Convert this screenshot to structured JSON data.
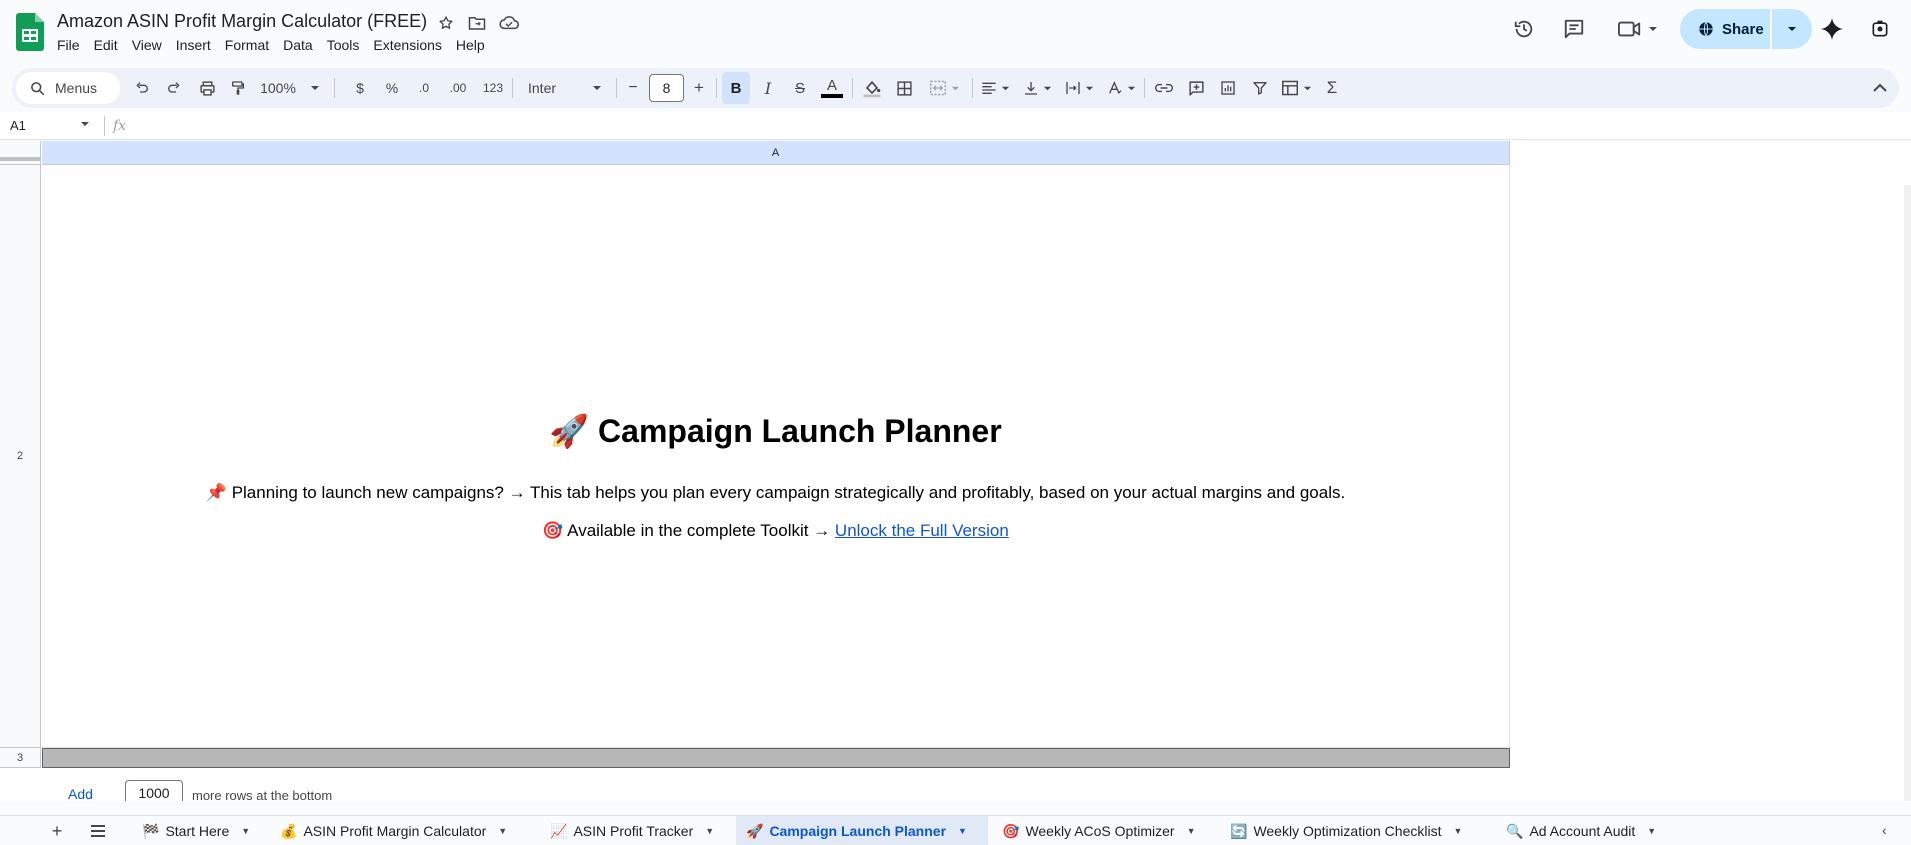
{
  "doc": {
    "title": "Amazon ASIN Profit Margin Calculator (FREE)"
  },
  "menu": [
    "File",
    "Edit",
    "View",
    "Insert",
    "Format",
    "Data",
    "Tools",
    "Extensions",
    "Help"
  ],
  "header": {
    "share_label": "Share"
  },
  "toolbar": {
    "search_label": "Menus",
    "zoom": "100%",
    "currency": "$",
    "percent": "%",
    "dec_decrease": ".0",
    "dec_increase": ".00",
    "number_format": "123",
    "font": "Inter",
    "font_size": "8",
    "minus": "−",
    "plus": "+",
    "bold": "B",
    "italic": "I",
    "strike": "S",
    "text_color": "A",
    "text_color_hex": "#000000",
    "sum": "Σ"
  },
  "formula_bar": {
    "cell_ref": "A1",
    "fx": "fx"
  },
  "grid": {
    "column_a": "A",
    "rows": [
      "2",
      "3"
    ],
    "heading_emoji": "🚀",
    "heading": "Campaign Launch Planner",
    "line1_emoji": "📌",
    "line1": "Planning to launch new campaigns? → This tab helps you plan every campaign strategically and profitably, based on your actual margins and goals.",
    "line2_emoji": "🎯",
    "line2": "Available in the complete Toolkit → ",
    "link": "Unlock the Full Version",
    "add_label": "Add",
    "add_count": "1000",
    "add_suffix": "more rows at the bottom"
  },
  "sheets": [
    {
      "emoji": "🏁",
      "label": "Start Here"
    },
    {
      "emoji": "💰",
      "label": "ASIN Profit Margin Calculator"
    },
    {
      "emoji": "📈",
      "label": "ASIN Profit Tracker"
    },
    {
      "emoji": "🚀",
      "label": "Campaign Launch Planner"
    },
    {
      "emoji": "🎯",
      "label": "Weekly ACoS Optimizer"
    },
    {
      "emoji": "🔄",
      "label": "Weekly Optimization Checklist"
    },
    {
      "emoji": "🔍",
      "label": "Ad Account Audit"
    }
  ],
  "colors": {
    "accent": "#0b57d0",
    "share_bg": "#c2e7ff",
    "app_green": "#0f9d58",
    "link": "#1155cc"
  }
}
